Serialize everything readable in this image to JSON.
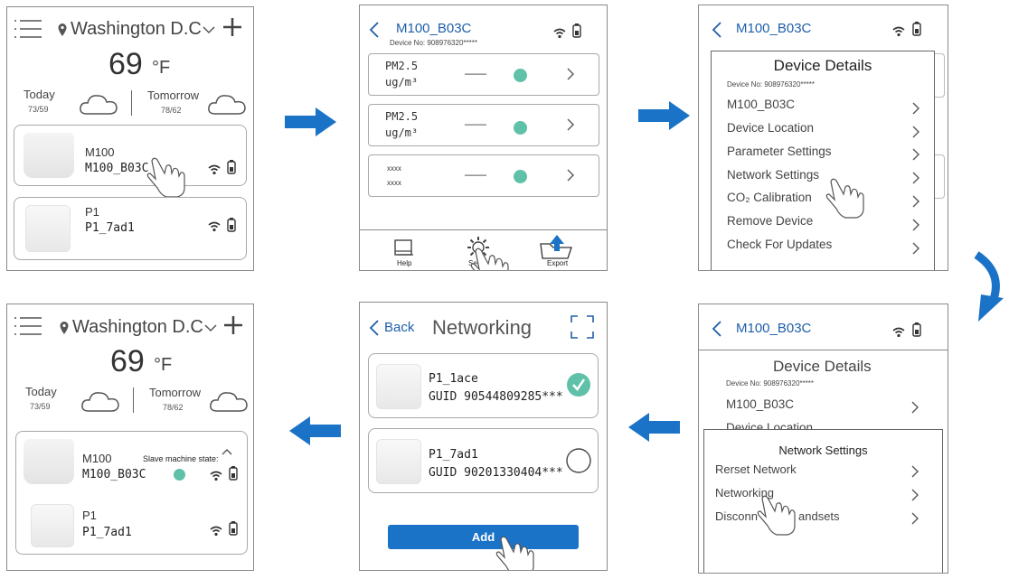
{
  "home": {
    "location": "Washington D.C",
    "temperature": "69",
    "unit": "°F",
    "today_label": "Today",
    "today_range": "73/59",
    "tomorrow_label": "Tomorrow",
    "tomorrow_range": "78/62",
    "devices": [
      {
        "type": "M100",
        "name": "M100_B03C"
      },
      {
        "type": "P1",
        "name": "P1_7ad1"
      }
    ],
    "slave_state_label": "Slave machine state:"
  },
  "device_screen": {
    "title": "M100_B03C",
    "device_no": "Device No: 908976320*****",
    "rows": [
      {
        "line1": "PM2.5",
        "line2": "ug/m³",
        "value": "——"
      },
      {
        "line1": "PM2.5",
        "line2": "ug/m³",
        "value": "——"
      },
      {
        "line1": "xxxx",
        "line2": "xxxx",
        "value": "——"
      }
    ],
    "toolbar": {
      "help": "Help",
      "settings": "Setti",
      "export": "Export"
    }
  },
  "details": {
    "title": "Device Details",
    "device_no": "Device No: 908976320*****",
    "items": [
      "M100_B03C",
      "Device Location",
      "Parameter Settings",
      "Network Settings",
      "CO₂ Calibration",
      "Remove Device",
      "Check For Updates"
    ]
  },
  "network_settings": {
    "title": "Network Settings",
    "items": [
      "Rerset Network",
      "Networking",
      "Disconnect Handsets"
    ],
    "disconnect_visible": "Disconn",
    "disconnect_tail": "andsets"
  },
  "networking": {
    "back": "Back",
    "title": "Networking",
    "devices": [
      {
        "name": "P1_1ace",
        "guid": "GUID 90544809285***",
        "selected": true
      },
      {
        "name": "P1_7ad1",
        "guid": "GUID 90201330404***",
        "selected": false
      }
    ],
    "add_label": "Add"
  },
  "colors": {
    "accent": "#1f5fa8",
    "status_dot": "#5fc1a8",
    "arrow": "#1a73c7"
  }
}
